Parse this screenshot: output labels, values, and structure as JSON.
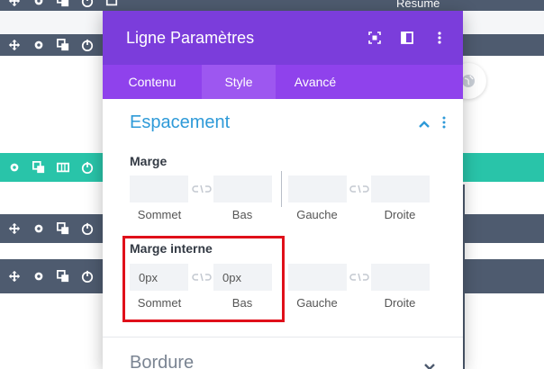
{
  "background": {
    "top_label": "Résumé"
  },
  "modal": {
    "title": "Ligne Paramètres",
    "tabs": [
      "Contenu",
      "Style",
      "Avancé"
    ],
    "active_tab": "Style",
    "section_title": "Espacement",
    "margin": {
      "label": "Marge",
      "fields": [
        {
          "label": "Sommet",
          "value": ""
        },
        {
          "label": "Bas",
          "value": ""
        },
        {
          "label": "Gauche",
          "value": ""
        },
        {
          "label": "Droite",
          "value": ""
        }
      ]
    },
    "padding": {
      "label": "Marge interne",
      "fields": [
        {
          "label": "Sommet",
          "value": "0px"
        },
        {
          "label": "Bas",
          "value": "0px"
        },
        {
          "label": "Gauche",
          "value": ""
        },
        {
          "label": "Droite",
          "value": ""
        }
      ]
    },
    "next_section_title": "Bordure"
  },
  "colors": {
    "purple_header": "#7b3ddb",
    "purple_tabs": "#8f42ec",
    "teal_row": "#29c4a9",
    "dark_row": "#4e5b6f",
    "section_blue": "#2e9ad8",
    "highlight_red": "#e0101a"
  },
  "icons": [
    "move-icon",
    "gear-icon",
    "duplicate-icon",
    "power-icon",
    "columns-icon",
    "fullscreen-icon",
    "split-view-icon",
    "kebab-menu-icon",
    "chevron-up-icon",
    "chevron-down-icon",
    "link-icon",
    "globe-icon"
  ]
}
